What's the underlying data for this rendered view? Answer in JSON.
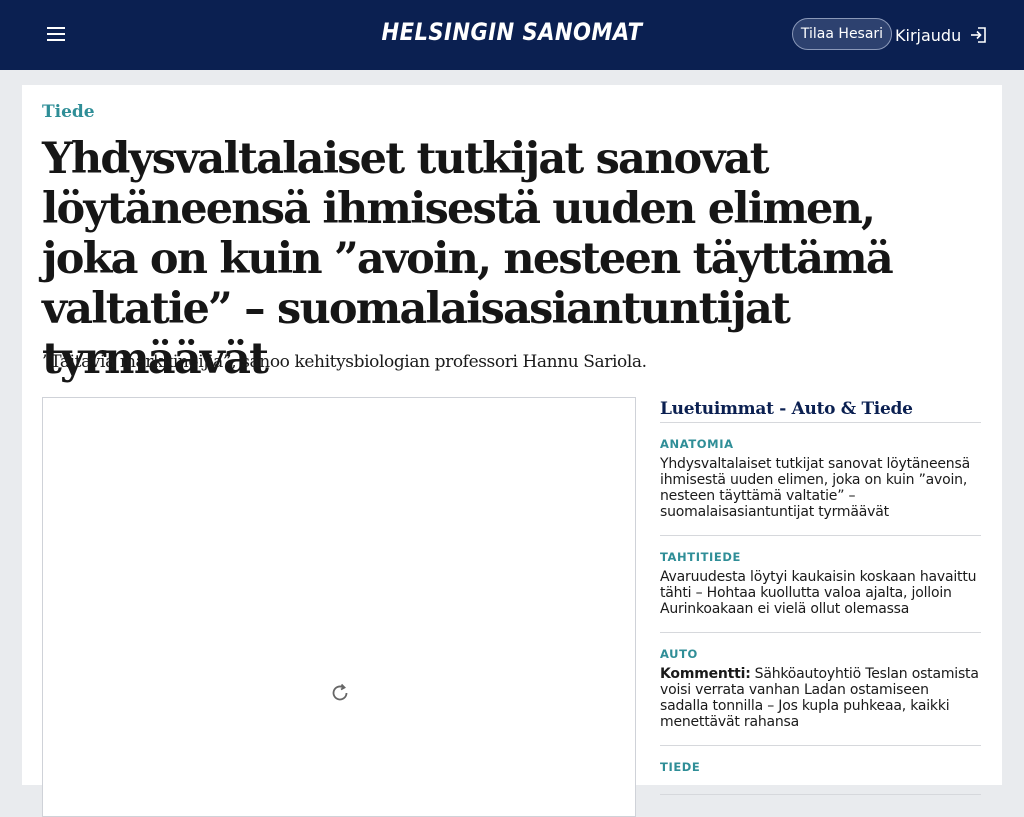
{
  "header": {
    "logo": "HELSINGIN SANOMAT",
    "subscribe_label": "Tilaa Hesari",
    "login_label": "Kirjaudu"
  },
  "article": {
    "section": "Tiede",
    "headline": "Yhdysvaltalaiset tutkijat sanovat löytäneensä ihmisestä uuden elimen, joka on kuin ”avoin, nesteen täyttämä valtatie” – suomalaisasiantuntijat tyrmäävät",
    "lead": "”Taitavia markkinoijia”, sanoo kehitysbiologian professori Hannu Sariola."
  },
  "sidebar": {
    "title": "Luetuimmat - Auto & Tiede",
    "items": [
      {
        "category": "ANATOMIA",
        "prefix": "",
        "title": "Yhdysvaltalaiset tutkijat sanovat löytäneensä ihmisestä uuden elimen, joka on kuin ”avoin, nesteen täyttämä valtatie” – suomalaisasiantuntijat tyrmäävät"
      },
      {
        "category": "TAHTITIEDE",
        "prefix": "",
        "title": "Avaruudesta löytyi kaukaisin koskaan havaittu tähti – Hohtaa kuollutta valoa ajalta, jolloin Aurinkoakaan ei vielä ollut olemassa"
      },
      {
        "category": "AUTO",
        "prefix": "Kommentti:",
        "title": "Sähköautoyhtiö Teslan ostamista voisi verrata vanhan Ladan ostamiseen sadalla tonnilla – Jos kupla puhkeaa, kaikki menettävät rahansa"
      },
      {
        "category": "TIEDE",
        "prefix": "",
        "title": ""
      }
    ]
  },
  "icons": {
    "menu": "hamburger-menu-icon",
    "login": "login-arrow-icon",
    "reload": "reload-icon"
  },
  "colors": {
    "header_bg": "#0b2051",
    "accent": "#2f8e97",
    "page_bg": "#e9ebee"
  }
}
